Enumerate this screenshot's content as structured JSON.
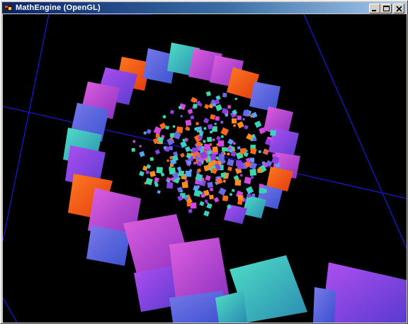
{
  "window": {
    "title": "MathEngine (OpenGL)",
    "icon": "mathengine-app-icon",
    "buttons": [
      "minimize-icon",
      "maximize-icon",
      "close-icon"
    ]
  },
  "scene": {
    "description_icon": "opengl-3d-viewport",
    "background": "#000000",
    "grid_color": "#1c1cff",
    "palette": [
      "#ff6a1a",
      "#d048e0",
      "#6a6ae8",
      "#3acfc0",
      "#8a40e0",
      "#ff8c20",
      "#40d8a8",
      "#5aa0ff"
    ]
  }
}
